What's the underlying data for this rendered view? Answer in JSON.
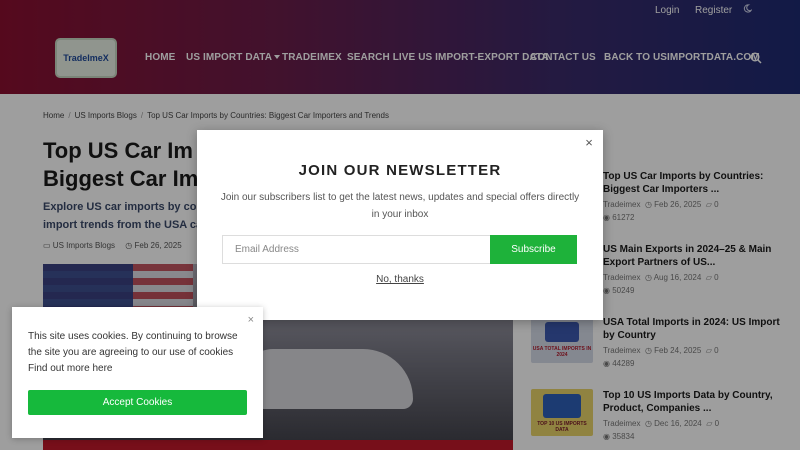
{
  "topbar": {
    "login": "Login",
    "register": "Register",
    "theme_icon": "moon-icon"
  },
  "logo": {
    "text": "TradeImeX"
  },
  "nav": {
    "home": "HOME",
    "us_import_data": "US IMPORT DATA",
    "tradeimex": "TRADEIMEX",
    "search_live": "SEARCH LIVE US IMPORT-EXPORT DATA",
    "contact": "CONTACT US",
    "back": "BACK TO USIMPORTDATA.COM",
    "search_icon": "search-icon"
  },
  "breadcrumb": [
    "Home",
    "US Imports Blogs",
    "Top US Car Imports by Countries: Biggest Car Importers and Trends"
  ],
  "article": {
    "title_line1": "Top US Car Im",
    "title_line2": "Biggest Car Im",
    "excerpt_line1": "Explore US car imports by coun",
    "excerpt_line2": "import trends from the USA ca",
    "category": "US Imports Blogs",
    "date": "Feb 26, 2025"
  },
  "sidebar": {
    "posts": [
      {
        "title": "Top US Car Imports by Countries: Biggest Car Importers ...",
        "author": "Tradeimex",
        "date": "Feb 26, 2025",
        "comments": "0",
        "views": "61272"
      },
      {
        "title": "US Main Exports in 2024–25 & Main Export Partners of US...",
        "author": "Tradeimex",
        "date": "Aug 16, 2024",
        "comments": "0",
        "views": "50249"
      },
      {
        "title": "USA Total Imports in 2024: US Import by Country",
        "author": "Tradeimex",
        "date": "Feb 24, 2025",
        "comments": "0",
        "views": "44289",
        "thumb_caption": "USA TOTAL IMPORTS IN 2024"
      },
      {
        "title": "Top 10 US Imports Data by Country, Product, Companies ...",
        "author": "Tradeimex",
        "date": "Dec 16, 2024",
        "comments": "0",
        "views": "35834",
        "thumb_caption": "TOP 10 US IMPORTS DATA"
      }
    ]
  },
  "newsletter": {
    "title": "JOIN OUR NEWSLETTER",
    "text": "Join our subscribers list to get the latest news, updates and special offers directly in your inbox",
    "email_placeholder": "Email Address",
    "subscribe": "Subscribe",
    "no_thanks": "No, thanks",
    "close": "×"
  },
  "cookie": {
    "text": "This site uses cookies. By continuing to browse the site you are agreeing to our use of cookies Find out more here",
    "accept": "Accept Cookies",
    "close": "×"
  },
  "colors": {
    "subscribe_green": "#1eb23a",
    "accept_green": "#16b93c",
    "header_left": "#8a1030",
    "header_right": "#1e2a72"
  }
}
